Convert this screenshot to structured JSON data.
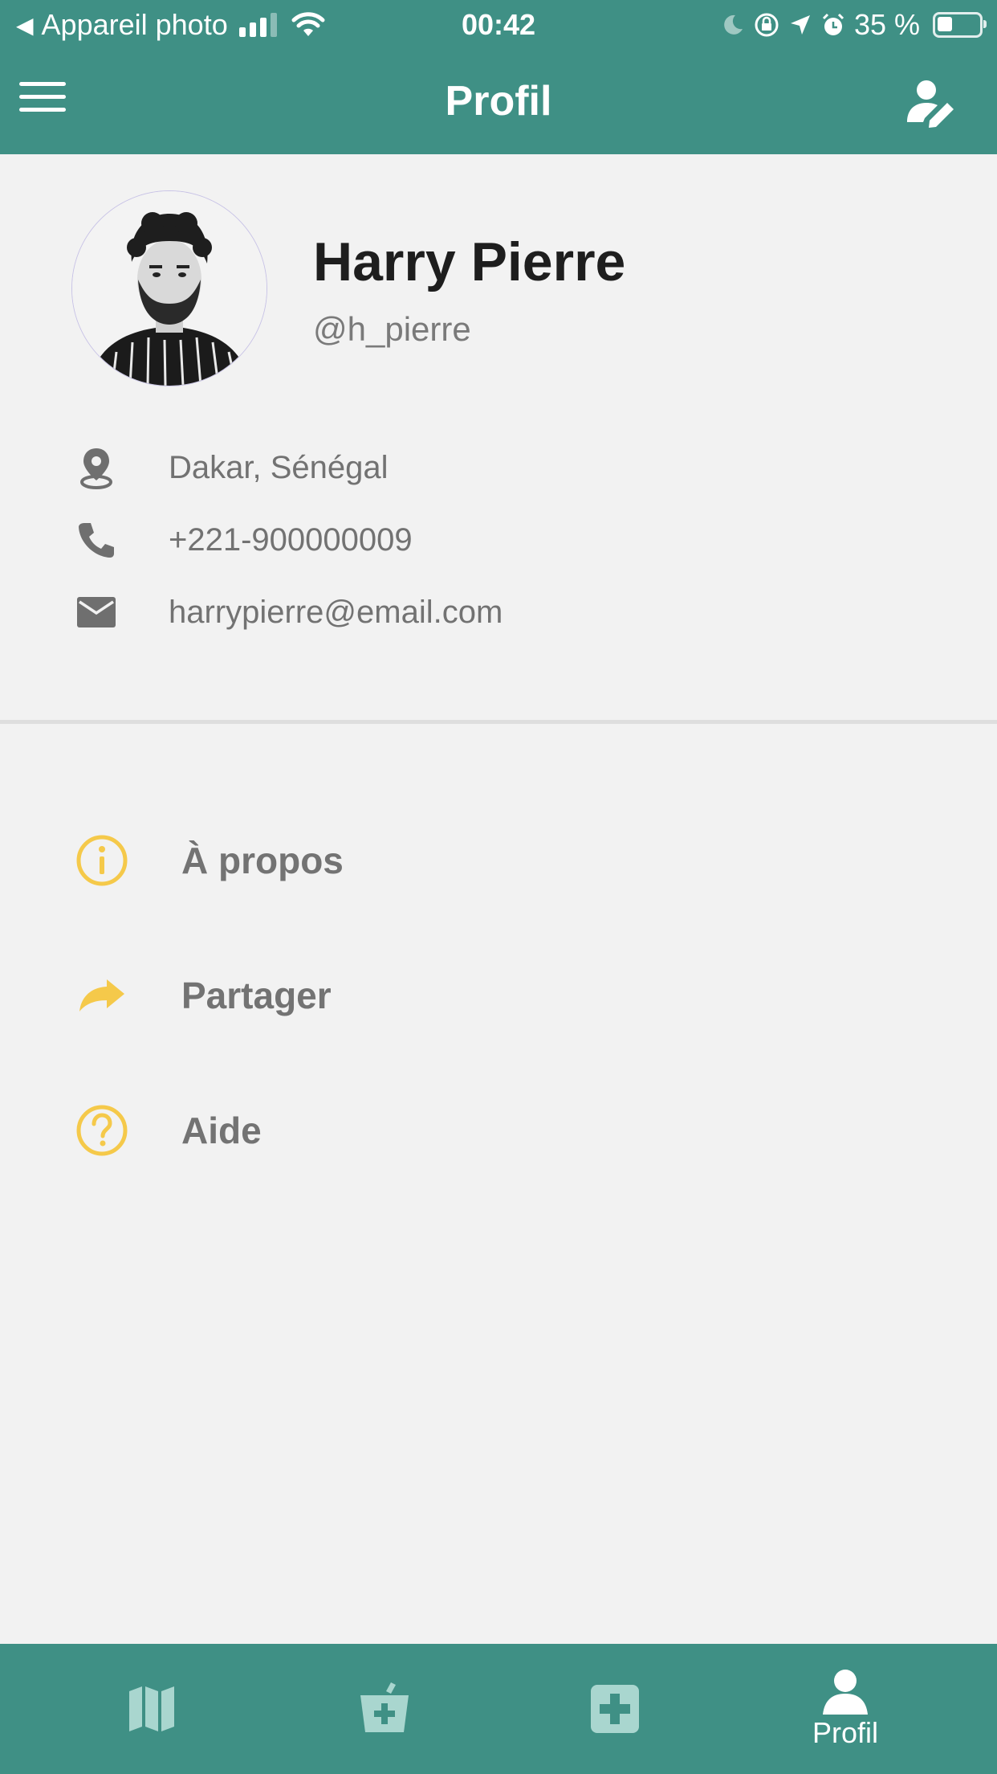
{
  "status_bar": {
    "back_label": "Appareil photo",
    "time": "00:42",
    "battery_text": "35 %",
    "battery_level": 0.35
  },
  "header": {
    "title": "Profil",
    "menu_icon": "hamburger-icon",
    "edit_icon": "edit-profile-icon"
  },
  "profile": {
    "name": "Harry Pierre",
    "handle": "@h_pierre",
    "location": "Dakar, Sénégal",
    "phone": "+221-900000009",
    "email": "harrypierre@email.com"
  },
  "menu": {
    "items": [
      {
        "label": "À propos",
        "icon": "info-icon"
      },
      {
        "label": "Partager",
        "icon": "share-icon"
      },
      {
        "label": "Aide",
        "icon": "help-icon"
      }
    ]
  },
  "bottom_nav": {
    "tabs": [
      {
        "icon": "map-icon",
        "label": ""
      },
      {
        "icon": "pharmacy-icon",
        "label": ""
      },
      {
        "icon": "medical-cross-icon",
        "label": ""
      },
      {
        "icon": "profile-icon",
        "label": "Profil",
        "active": true
      }
    ]
  },
  "colors": {
    "primary": "#3f9085",
    "accent": "#f5c94a",
    "background": "#f2f2f2",
    "inactive_tab": "#a9d6cf"
  }
}
